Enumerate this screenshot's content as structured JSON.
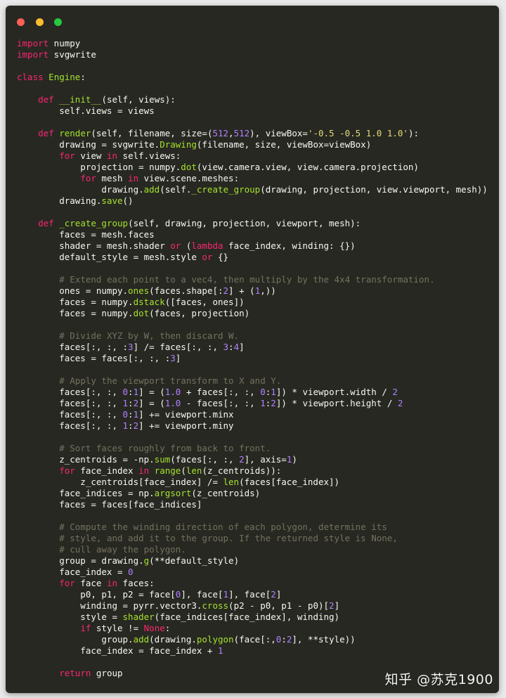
{
  "colors": {
    "background": "#272822",
    "keyword": "#f92672",
    "function": "#a6e22e",
    "number": "#ae81ff",
    "string": "#e6db74",
    "comment": "#75715e",
    "plain": "#f8f8f2",
    "dot_close": "#ff5f56",
    "dot_minimize": "#ffbd2e",
    "dot_zoom": "#27c93f"
  },
  "window": {
    "controls": [
      "close-dot",
      "minimize-dot",
      "zoom-dot"
    ]
  },
  "watermark": "知乎 @苏克1900",
  "code_lines": [
    [
      [
        "k",
        "import"
      ],
      [
        "p",
        " numpy"
      ]
    ],
    [
      [
        "k",
        "import"
      ],
      [
        "p",
        " svgwrite"
      ]
    ],
    [],
    [
      [
        "k",
        "class"
      ],
      [
        "p",
        " "
      ],
      [
        "f",
        "Engine"
      ],
      [
        "p",
        ":"
      ]
    ],
    [],
    [
      [
        "p",
        "    "
      ],
      [
        "k",
        "def"
      ],
      [
        "p",
        " "
      ],
      [
        "f",
        "__init__"
      ],
      [
        "p",
        "(self, views):"
      ]
    ],
    [
      [
        "p",
        "        self.views = views"
      ]
    ],
    [],
    [
      [
        "p",
        "    "
      ],
      [
        "k",
        "def"
      ],
      [
        "p",
        " "
      ],
      [
        "f",
        "render"
      ],
      [
        "p",
        "(self, filename, size=("
      ],
      [
        "n",
        "512"
      ],
      [
        "p",
        ","
      ],
      [
        "n",
        "512"
      ],
      [
        "p",
        "), viewBox="
      ],
      [
        "s",
        "'-0.5 -0.5 1.0 1.0'"
      ],
      [
        "p",
        "):"
      ]
    ],
    [
      [
        "p",
        "        drawing = svgwrite."
      ],
      [
        "f",
        "Drawing"
      ],
      [
        "p",
        "(filename, size, viewBox=viewBox)"
      ]
    ],
    [
      [
        "p",
        "        "
      ],
      [
        "k",
        "for"
      ],
      [
        "p",
        " view "
      ],
      [
        "k",
        "in"
      ],
      [
        "p",
        " self.views:"
      ]
    ],
    [
      [
        "p",
        "            projection = numpy."
      ],
      [
        "f",
        "dot"
      ],
      [
        "p",
        "(view.camera.view, view.camera.projection)"
      ]
    ],
    [
      [
        "p",
        "            "
      ],
      [
        "k",
        "for"
      ],
      [
        "p",
        " mesh "
      ],
      [
        "k",
        "in"
      ],
      [
        "p",
        " view.scene.meshes:"
      ]
    ],
    [
      [
        "p",
        "                drawing."
      ],
      [
        "f",
        "add"
      ],
      [
        "p",
        "(self."
      ],
      [
        "f",
        "_create_group"
      ],
      [
        "p",
        "(drawing, projection, view.viewport, mesh))"
      ]
    ],
    [
      [
        "p",
        "        drawing."
      ],
      [
        "f",
        "save"
      ],
      [
        "p",
        "()"
      ]
    ],
    [],
    [
      [
        "p",
        "    "
      ],
      [
        "k",
        "def"
      ],
      [
        "p",
        " "
      ],
      [
        "f",
        "_create_group"
      ],
      [
        "p",
        "(self, drawing, projection, viewport, mesh):"
      ]
    ],
    [
      [
        "p",
        "        faces = mesh.faces"
      ]
    ],
    [
      [
        "p",
        "        shader = mesh.shader "
      ],
      [
        "k",
        "or"
      ],
      [
        "p",
        " ("
      ],
      [
        "k",
        "lambda"
      ],
      [
        "p",
        " face_index, winding: {})"
      ]
    ],
    [
      [
        "p",
        "        default_style = mesh.style "
      ],
      [
        "k",
        "or"
      ],
      [
        "p",
        " {}"
      ]
    ],
    [],
    [
      [
        "p",
        "        "
      ],
      [
        "c",
        "# Extend each point to a vec4, then multiply by the 4x4 transformation."
      ]
    ],
    [
      [
        "p",
        "        ones = numpy."
      ],
      [
        "f",
        "ones"
      ],
      [
        "p",
        "(faces.shape[:"
      ],
      [
        "n",
        "2"
      ],
      [
        "p",
        "] + ("
      ],
      [
        "n",
        "1"
      ],
      [
        "p",
        ",))"
      ]
    ],
    [
      [
        "p",
        "        faces = numpy."
      ],
      [
        "f",
        "dstack"
      ],
      [
        "p",
        "([faces, ones])"
      ]
    ],
    [
      [
        "p",
        "        faces = numpy."
      ],
      [
        "f",
        "dot"
      ],
      [
        "p",
        "(faces, projection)"
      ]
    ],
    [],
    [
      [
        "p",
        "        "
      ],
      [
        "c",
        "# Divide XYZ by W, then discard W."
      ]
    ],
    [
      [
        "p",
        "        faces[:, :, :"
      ],
      [
        "n",
        "3"
      ],
      [
        "p",
        "] /= faces[:, :, "
      ],
      [
        "n",
        "3"
      ],
      [
        "p",
        ":"
      ],
      [
        "n",
        "4"
      ],
      [
        "p",
        "]"
      ]
    ],
    [
      [
        "p",
        "        faces = faces[:, :, :"
      ],
      [
        "n",
        "3"
      ],
      [
        "p",
        "]"
      ]
    ],
    [],
    [
      [
        "p",
        "        "
      ],
      [
        "c",
        "# Apply the viewport transform to X and Y."
      ]
    ],
    [
      [
        "p",
        "        faces[:, :, "
      ],
      [
        "n",
        "0"
      ],
      [
        "p",
        ":"
      ],
      [
        "n",
        "1"
      ],
      [
        "p",
        "] = ("
      ],
      [
        "n",
        "1.0"
      ],
      [
        "p",
        " + faces[:, :, "
      ],
      [
        "n",
        "0"
      ],
      [
        "p",
        ":"
      ],
      [
        "n",
        "1"
      ],
      [
        "p",
        "]) * viewport.width / "
      ],
      [
        "n",
        "2"
      ]
    ],
    [
      [
        "p",
        "        faces[:, :, "
      ],
      [
        "n",
        "1"
      ],
      [
        "p",
        ":"
      ],
      [
        "n",
        "2"
      ],
      [
        "p",
        "] = ("
      ],
      [
        "n",
        "1.0"
      ],
      [
        "p",
        " - faces[:, :, "
      ],
      [
        "n",
        "1"
      ],
      [
        "p",
        ":"
      ],
      [
        "n",
        "2"
      ],
      [
        "p",
        "]) * viewport.height / "
      ],
      [
        "n",
        "2"
      ]
    ],
    [
      [
        "p",
        "        faces[:, :, "
      ],
      [
        "n",
        "0"
      ],
      [
        "p",
        ":"
      ],
      [
        "n",
        "1"
      ],
      [
        "p",
        "] += viewport.minx"
      ]
    ],
    [
      [
        "p",
        "        faces[:, :, "
      ],
      [
        "n",
        "1"
      ],
      [
        "p",
        ":"
      ],
      [
        "n",
        "2"
      ],
      [
        "p",
        "] += viewport.miny"
      ]
    ],
    [],
    [
      [
        "p",
        "        "
      ],
      [
        "c",
        "# Sort faces roughly from back to front."
      ]
    ],
    [
      [
        "p",
        "        z_centroids = -np."
      ],
      [
        "f",
        "sum"
      ],
      [
        "p",
        "(faces[:, :, "
      ],
      [
        "n",
        "2"
      ],
      [
        "p",
        "], axis="
      ],
      [
        "n",
        "1"
      ],
      [
        "p",
        ")"
      ]
    ],
    [
      [
        "p",
        "        "
      ],
      [
        "k",
        "for"
      ],
      [
        "p",
        " face_index "
      ],
      [
        "k",
        "in"
      ],
      [
        "p",
        " "
      ],
      [
        "f",
        "range"
      ],
      [
        "p",
        "("
      ],
      [
        "f",
        "len"
      ],
      [
        "p",
        "(z_centroids)):"
      ]
    ],
    [
      [
        "p",
        "            z_centroids[face_index] /= "
      ],
      [
        "f",
        "len"
      ],
      [
        "p",
        "(faces[face_index])"
      ]
    ],
    [
      [
        "p",
        "        face_indices = np."
      ],
      [
        "f",
        "argsort"
      ],
      [
        "p",
        "(z_centroids)"
      ]
    ],
    [
      [
        "p",
        "        faces = faces[face_indices]"
      ]
    ],
    [],
    [
      [
        "p",
        "        "
      ],
      [
        "c",
        "# Compute the winding direction of each polygon, determine its"
      ]
    ],
    [
      [
        "p",
        "        "
      ],
      [
        "c",
        "# style, and add it to the group. If the returned style is None,"
      ]
    ],
    [
      [
        "p",
        "        "
      ],
      [
        "c",
        "# cull away the polygon."
      ]
    ],
    [
      [
        "p",
        "        group = drawing."
      ],
      [
        "f",
        "g"
      ],
      [
        "p",
        "(**default_style)"
      ]
    ],
    [
      [
        "p",
        "        face_index = "
      ],
      [
        "n",
        "0"
      ]
    ],
    [
      [
        "p",
        "        "
      ],
      [
        "k",
        "for"
      ],
      [
        "p",
        " face "
      ],
      [
        "k",
        "in"
      ],
      [
        "p",
        " faces:"
      ]
    ],
    [
      [
        "p",
        "            p0, p1, p2 = face["
      ],
      [
        "n",
        "0"
      ],
      [
        "p",
        "], face["
      ],
      [
        "n",
        "1"
      ],
      [
        "p",
        "], face["
      ],
      [
        "n",
        "2"
      ],
      [
        "p",
        "]"
      ]
    ],
    [
      [
        "p",
        "            winding = pyrr.vector3."
      ],
      [
        "f",
        "cross"
      ],
      [
        "p",
        "(p2 - p0, p1 - p0)["
      ],
      [
        "n",
        "2"
      ],
      [
        "p",
        "]"
      ]
    ],
    [
      [
        "p",
        "            style = "
      ],
      [
        "f",
        "shader"
      ],
      [
        "p",
        "(face_indices[face_index], winding)"
      ]
    ],
    [
      [
        "p",
        "            "
      ],
      [
        "k",
        "if"
      ],
      [
        "p",
        " style != "
      ],
      [
        "k",
        "None"
      ],
      [
        "p",
        ":"
      ]
    ],
    [
      [
        "p",
        "                group."
      ],
      [
        "f",
        "add"
      ],
      [
        "p",
        "(drawing."
      ],
      [
        "f",
        "polygon"
      ],
      [
        "p",
        "(face[:,"
      ],
      [
        "n",
        "0"
      ],
      [
        "p",
        ":"
      ],
      [
        "n",
        "2"
      ],
      [
        "p",
        "], **style))"
      ]
    ],
    [
      [
        "p",
        "            face_index = face_index + "
      ],
      [
        "n",
        "1"
      ]
    ],
    [],
    [
      [
        "p",
        "        "
      ],
      [
        "k",
        "return"
      ],
      [
        "p",
        " group"
      ]
    ]
  ]
}
